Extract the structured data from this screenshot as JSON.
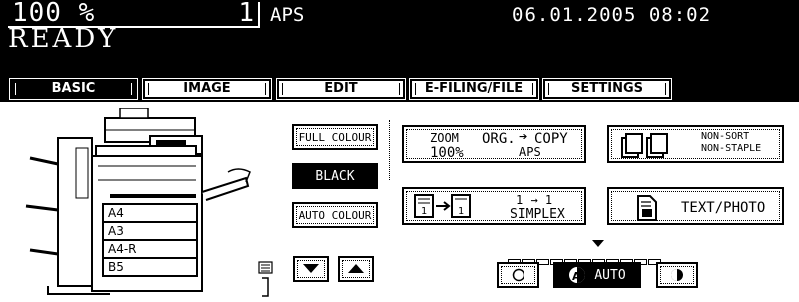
{
  "status": {
    "zoom": "100 %",
    "copies": "1",
    "paper_mode": "APS",
    "datetime": "06.01.2005 08:02",
    "state": "READY"
  },
  "tabs": [
    {
      "label": "BASIC",
      "active": true
    },
    {
      "label": "IMAGE",
      "active": false
    },
    {
      "label": "EDIT",
      "active": false
    },
    {
      "label": "E-FILING/FILE",
      "active": false
    },
    {
      "label": "SETTINGS",
      "active": false
    }
  ],
  "trays": [
    "A4",
    "A3",
    "A4-R",
    "B5"
  ],
  "color_modes": {
    "full": "FULL COLOUR",
    "black": "BLACK",
    "auto": "AUTO COLOUR",
    "selected": "BLACK"
  },
  "zoom_button": {
    "line1": "ZOOM",
    "value": "100%",
    "org": "ORG.",
    "arrow": "➔",
    "copy": "COPY",
    "aps": "APS"
  },
  "finishing_button": {
    "line1": "NON-SORT",
    "line2": "NON-STAPLE"
  },
  "duplex_button": {
    "line1": "1 → 1",
    "line2": "SIMPLEX"
  },
  "original_mode_button": {
    "label": "TEXT/PHOTO"
  },
  "density": {
    "auto_label": "AUTO",
    "segments": 11,
    "indicator_index": 6
  },
  "icons": [
    "printer-icon",
    "finisher-icon",
    "document-icon",
    "duplex-icon",
    "text-photo-icon",
    "down-arrow-icon",
    "up-arrow-icon",
    "lighter-icon",
    "darker-icon",
    "auto-density-icon",
    "sheets-icon"
  ]
}
